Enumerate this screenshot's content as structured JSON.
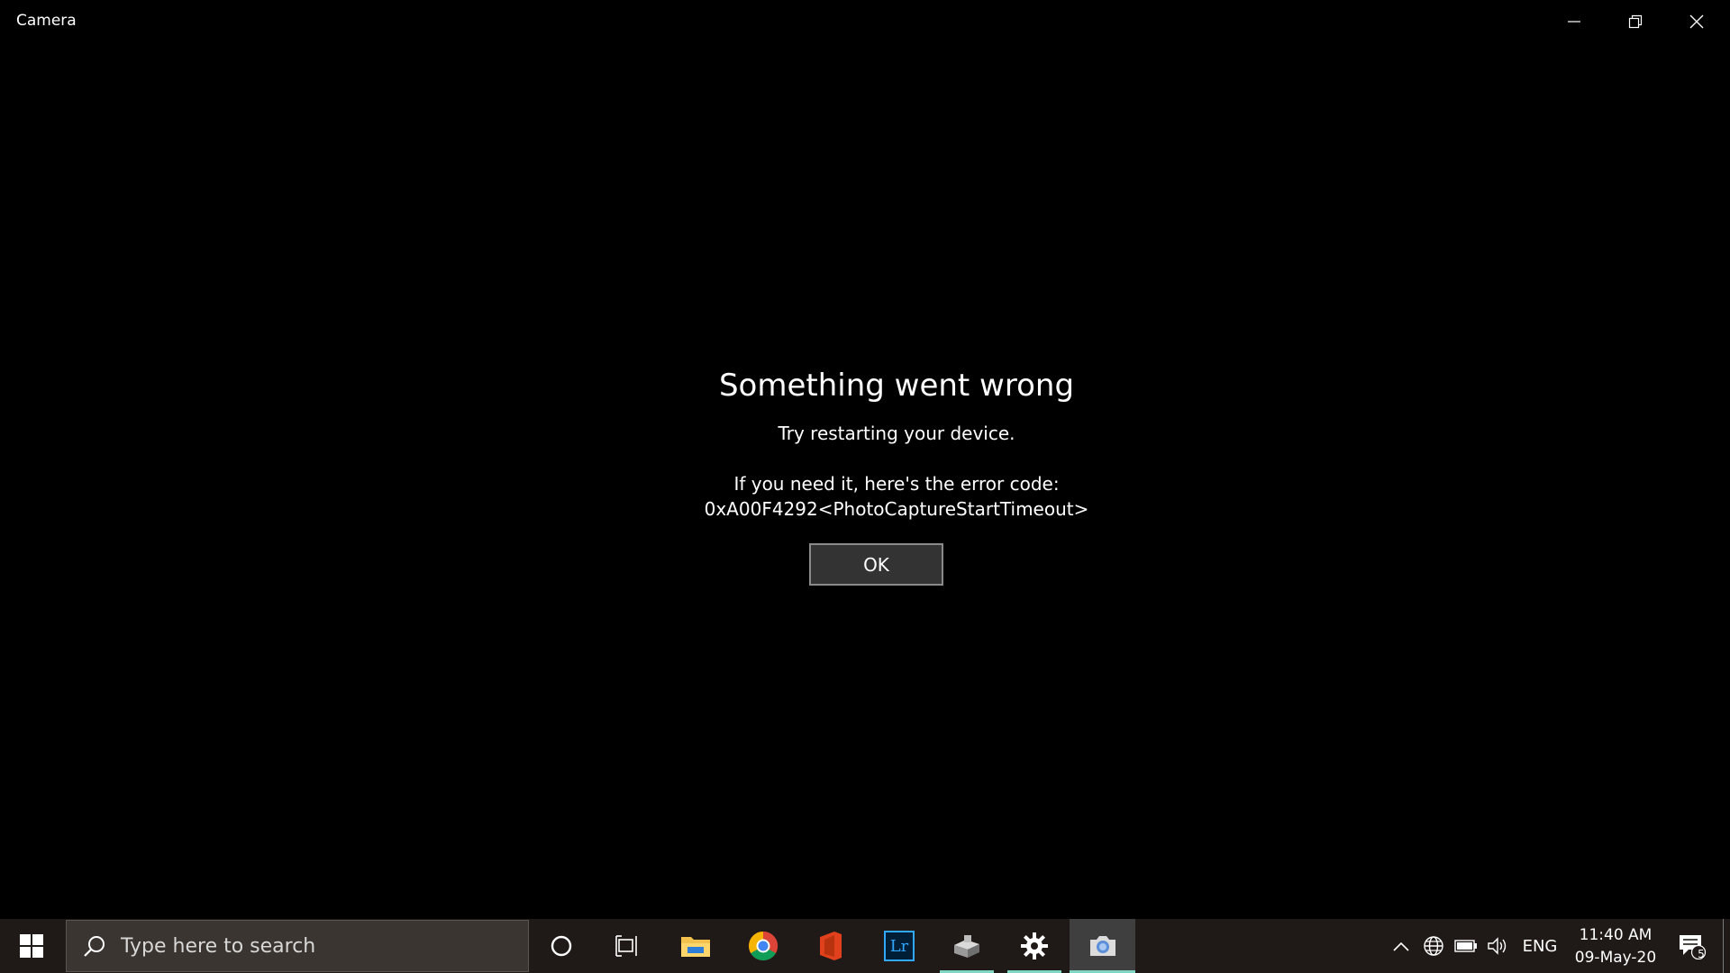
{
  "window": {
    "title": "Camera",
    "minimize_icon": "minimize-icon",
    "maximize_icon": "restore-icon",
    "close_icon": "close-icon"
  },
  "error": {
    "title": "Something went wrong",
    "hint": "Try restarting your device.",
    "code_label": "If you need it, here's the error code:",
    "code": "0xA00F4292<PhotoCaptureStartTimeout>",
    "ok_label": "OK"
  },
  "taskbar": {
    "search_placeholder": "Type here to search",
    "apps": [
      {
        "name": "file-explorer",
        "icon": "folder-icon"
      },
      {
        "name": "chrome",
        "icon": "chrome-icon"
      },
      {
        "name": "office",
        "icon": "office-icon"
      },
      {
        "name": "lightroom",
        "icon": "lightroom-icon",
        "label": "Lr"
      },
      {
        "name": "tool",
        "icon": "tool-icon"
      },
      {
        "name": "settings",
        "icon": "gear-icon"
      },
      {
        "name": "camera",
        "icon": "camera-icon"
      }
    ],
    "tray": {
      "language": "ENG",
      "time": "11:40 AM",
      "date": "09-May-20",
      "notification_count": "5"
    }
  },
  "colors": {
    "background": "#000000",
    "taskbar": "#1f1a17",
    "accent_running": "#7fd6c2",
    "button_bg": "#333333",
    "button_border": "#8a8a8a"
  }
}
